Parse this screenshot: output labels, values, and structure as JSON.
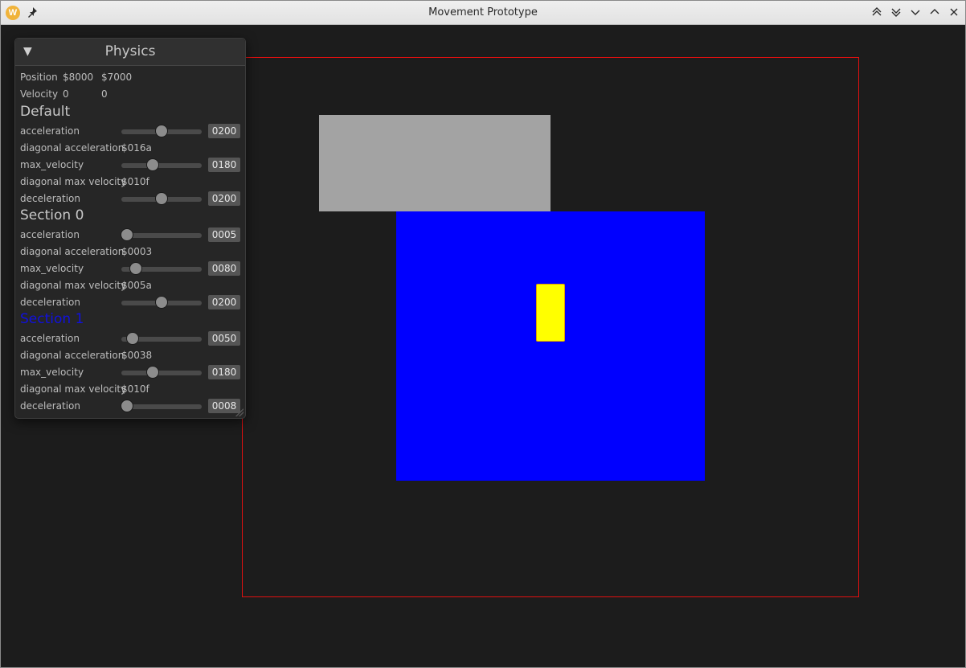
{
  "window": {
    "title": "Movement Prototype",
    "app_icon_letter": "W"
  },
  "panel": {
    "title": "Physics",
    "position": {
      "label": "Position",
      "x": "$8000",
      "y": "$7000"
    },
    "velocity": {
      "label": "Velocity",
      "x": "0",
      "y": "0"
    },
    "sections": [
      {
        "title": "Default",
        "active": false,
        "rows": [
          {
            "label": "acceleration",
            "type": "slider",
            "value": "0200",
            "level": 0.5
          },
          {
            "label": "diagonal acceleration",
            "type": "text",
            "value": "$016a"
          },
          {
            "label": "max_velocity",
            "type": "slider",
            "value": "0180",
            "level": 0.39
          },
          {
            "label": "diagonal max velocity",
            "type": "text",
            "value": "$010f"
          },
          {
            "label": "deceleration",
            "type": "slider",
            "value": "0200",
            "level": 0.5
          }
        ]
      },
      {
        "title": "Section 0",
        "active": false,
        "rows": [
          {
            "label": "acceleration",
            "type": "slider",
            "value": "0005",
            "level": 0.07
          },
          {
            "label": "diagonal acceleration",
            "type": "text",
            "value": "$0003"
          },
          {
            "label": "max_velocity",
            "type": "slider",
            "value": "0080",
            "level": 0.18
          },
          {
            "label": "diagonal max velocity",
            "type": "text",
            "value": "$005a"
          },
          {
            "label": "deceleration",
            "type": "slider",
            "value": "0200",
            "level": 0.5
          }
        ]
      },
      {
        "title": "Section 1",
        "active": true,
        "rows": [
          {
            "label": "acceleration",
            "type": "slider",
            "value": "0050",
            "level": 0.14
          },
          {
            "label": "diagonal acceleration",
            "type": "text",
            "value": "$0038"
          },
          {
            "label": "max_velocity",
            "type": "slider",
            "value": "0180",
            "level": 0.39
          },
          {
            "label": "diagonal max velocity",
            "type": "text",
            "value": "$010f"
          },
          {
            "label": "deceleration",
            "type": "slider",
            "value": "0008",
            "level": 0.07
          }
        ]
      }
    ]
  },
  "scene": {
    "bounds_color": "#e01010",
    "section0_color": "#a3a3a3",
    "section1_color": "#0000ff",
    "player_color": "#ffff00"
  }
}
